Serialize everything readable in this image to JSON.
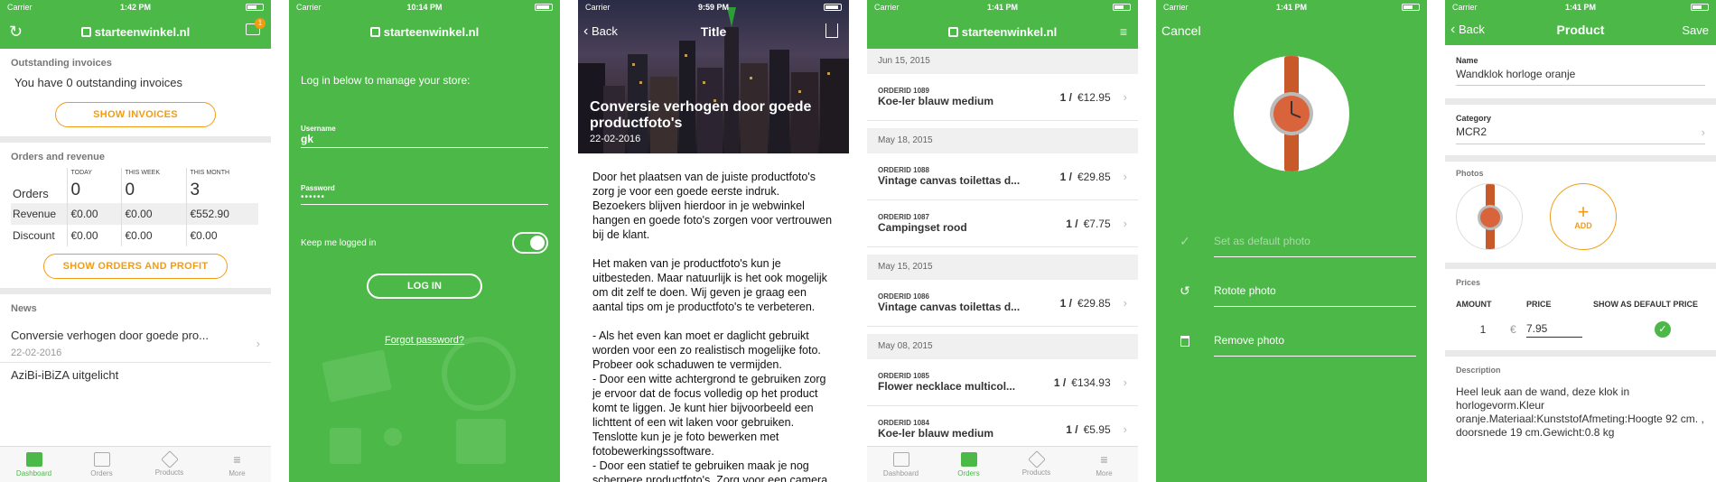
{
  "status": {
    "carrier": "Carrier",
    "times": [
      "1:42 PM",
      "10:14 PM",
      "9:59 PM",
      "1:41 PM",
      "1:41 PM",
      "1:41 PM"
    ]
  },
  "brand": "starteenwinkel.nl",
  "colors": {
    "green": "#4cb848",
    "orange": "#f39c12"
  },
  "dashboard": {
    "badge": "1",
    "invoices_title": "Outstanding invoices",
    "invoices_text": "You have 0 outstanding invoices",
    "show_invoices": "SHOW INVOICES",
    "orders_title": "Orders and revenue",
    "columns": [
      "TODAY",
      "THIS WEEK",
      "THIS MONTH"
    ],
    "rows": [
      {
        "label": "Orders",
        "values": [
          "0",
          "0",
          "3"
        ]
      },
      {
        "label": "Revenue",
        "values": [
          "€0.00",
          "€0.00",
          "€552.90"
        ]
      },
      {
        "label": "Discount",
        "values": [
          "€0.00",
          "€0.00",
          "€0.00"
        ]
      }
    ],
    "show_orders": "SHOW ORDERS AND PROFIT",
    "news_title": "News",
    "news_item_title": "Conversie verhogen door goede pro...",
    "news_item_date": "22-02-2016",
    "news_item2": "AziBi-iBiZA uitgelicht"
  },
  "tabs": [
    {
      "label": "Dashboard",
      "icon": "dashboard-icon"
    },
    {
      "label": "Orders",
      "icon": "orders-icon"
    },
    {
      "label": "Products",
      "icon": "tag-icon"
    },
    {
      "label": "More",
      "icon": "menu-icon"
    }
  ],
  "login": {
    "intro": "Log in below to manage your store:",
    "username_label": "Username",
    "username_value": "gk",
    "password_label": "Password",
    "password_value": "••••••",
    "keep_logged": "Keep me logged in",
    "login_button": "LOG IN",
    "forgot": "Forgot password?"
  },
  "article": {
    "back": "Back",
    "nav_title": "Title",
    "headline": "Conversie verhogen door goede productfoto's",
    "date": "22-02-2016",
    "paragraphs": [
      "Door het plaatsen van de juiste productfoto's zorg je voor een goede eerste indruk. Bezoekers blijven hierdoor in je webwinkel hangen en goede foto's zorgen voor vertrouwen bij de klant.",
      "Het maken van je productfoto's kun je uitbesteden. Maar natuurlijk is het ook mogelijk om dit zelf te doen. Wij geven je graag een aantal tips om je productfoto's te verbeteren.",
      "- Als het even kan moet er daglicht gebruikt worden voor een zo realistisch mogelijke foto. Probeer ook schaduwen te vermijden.\n- Door een witte achtergrond te gebruiken zorg je ervoor dat de focus volledig op het product komt te liggen. Je kunt hier bijvoorbeeld een lichttent of een wit laken voor gebruiken. Tenslotte kun je je foto bewerken met fotobewerkingssoftware.\n- Door een statief te gebruiken maak je nog scherpere productfoto's. Zorg voor een camera"
    ]
  },
  "orders": {
    "groups": [
      {
        "date": "Jun 15, 2015",
        "items": [
          {
            "id": "ORDERID 1089",
            "name": "Koe-ler blauw medium",
            "qty": "1 /",
            "price": "€12.95"
          }
        ]
      },
      {
        "date": "May 18, 2015",
        "items": [
          {
            "id": "ORDERID 1088",
            "name": "Vintage canvas toilettas d...",
            "qty": "1 /",
            "price": "€29.85"
          },
          {
            "id": "ORDERID 1087",
            "name": "Campingset rood",
            "qty": "1 /",
            "price": "€7.75"
          }
        ]
      },
      {
        "date": "May 15, 2015",
        "items": [
          {
            "id": "ORDERID 1086",
            "name": "Vintage canvas toilettas d...",
            "qty": "1 /",
            "price": "€29.85"
          }
        ]
      },
      {
        "date": "May 08, 2015",
        "items": [
          {
            "id": "ORDERID 1085",
            "name": "Flower necklace multicol...",
            "qty": "1 /",
            "price": "€134.93"
          },
          {
            "id": "ORDERID 1084",
            "name": "Koe-ler blauw medium",
            "qty": "1 /",
            "price": "€5.95"
          }
        ]
      }
    ]
  },
  "photo": {
    "cancel": "Cancel",
    "set_default": "Set as default photo",
    "rotate": "Rotote photo",
    "remove": "Remove photo"
  },
  "product": {
    "back": "Back",
    "title": "Product",
    "save": "Save",
    "name_label": "Name",
    "name_value": "Wandklok horloge oranje",
    "category_label": "Category",
    "category_value": "MCR2",
    "photos_label": "Photos",
    "add": "ADD",
    "prices_label": "Prices",
    "price_cols": [
      "AMOUNT",
      "PRICE",
      "SHOW AS DEFAULT PRICE"
    ],
    "amount": "1",
    "currency": "€",
    "price_value": "7.95",
    "description_label": "Description",
    "description": "Heel leuk aan de wand, deze klok in horlogevorm.Kleur oranje.Materiaal:KunststofAfmeting:Hoogte 92 cm. , doorsnede 19 cm.Gewicht:0.8 kg"
  }
}
